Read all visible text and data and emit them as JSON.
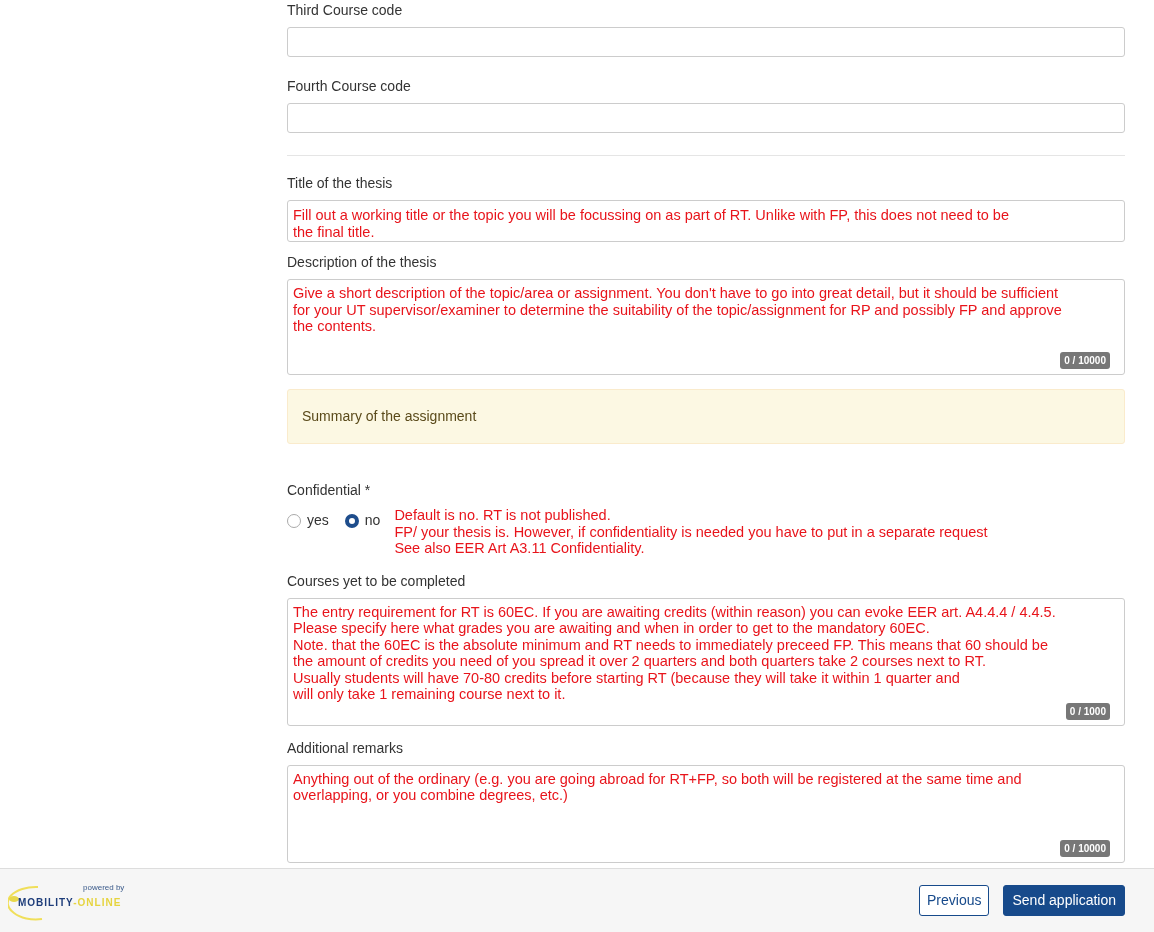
{
  "course_codes": [
    {
      "label": "Third Course code"
    },
    {
      "label": "Fourth Course code"
    }
  ],
  "thesis": {
    "title_field": {
      "label": "Title of the thesis",
      "annotation": "Fill out a working title or the topic you will be focussing on as part of RT. Unlike with FP, this does not need to be\nthe final title."
    },
    "description_field": {
      "label": "Description of the thesis",
      "annotation": "Give a short description of the topic/area or assignment. You don't have to go into great detail, but it should be sufficient\nfor your UT supervisor/examiner to determine the suitability of the topic/assignment for RP and possibly FP and approve\nthe contents.",
      "counter": "0 / 10000"
    },
    "summary_panel": "Summary of the assignment"
  },
  "confidential": {
    "label": "Confidential *",
    "options": [
      {
        "label": "yes",
        "selected": false
      },
      {
        "label": "no",
        "selected": true
      }
    ],
    "annotation": "Default is no. RT is not published.\nFP/ your thesis is. However, if confidentiality is needed you have to put in a separate request\nSee also EER Art A3.11 Confidentiality."
  },
  "courses_field": {
    "label": "Courses yet to be completed",
    "annotation": "The entry requirement for RT is 60EC. If you are awaiting credits (within reason) you can evoke EER art. A4.4.4 / 4.4.5.\nPlease specify here what grades you are awaiting and when in order to get to the mandatory 60EC.\nNote. that the 60EC is the absolute minimum and RT needs to immediately preceed FP. This means that 60 should be\nthe amount of credits you need of you spread it over 2 quarters and both quarters take 2 courses next to RT.\nUsually students will have 70-80 credits before starting RT (because they will take it within 1 quarter and\nwill only take 1 remaining course next to it.",
    "counter": "0 / 1000"
  },
  "remarks_field": {
    "label": "Additional remarks",
    "annotation": "Anything out of the ordinary (e.g. you are going abroad for RT+FP, so both will be registered at the same time and\noverlapping, or you combine degrees, etc.)",
    "counter": "0 / 10000"
  },
  "footer": {
    "logo": {
      "tagline": "powered by",
      "word1": "MOBILITY",
      "word2": "-ONLINE"
    },
    "buttons": [
      {
        "label": "Previous",
        "kind": "secondary"
      },
      {
        "label": "Send application",
        "kind": "primary"
      }
    ]
  }
}
